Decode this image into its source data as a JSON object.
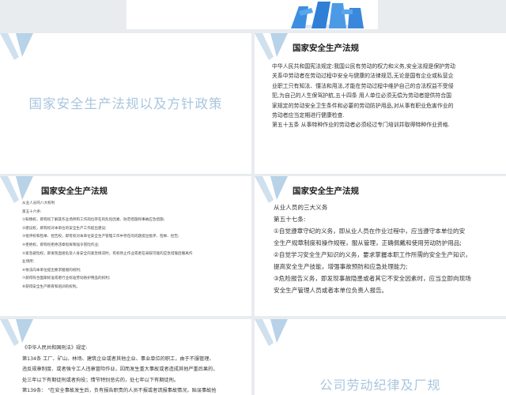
{
  "slides": {
    "s2": {
      "title": "国家安全生产法规以及方针政策"
    },
    "s3": {
      "title": "国家安全生产法规",
      "lines": [
        "中华人民共和国宪法规定:我国公民有劳动的权力和义务,安全法规是保护劳动",
        "关系中劳动者在劳动过程中安全与健康的法律规范,无论是国有企业或私营企",
        "业职工只有知法、懂法和用法,才能在劳动过程中维护自己的合法权益不受侵",
        "犯,为自己的人生保驾护航,五十四条  用人单位必须无偿为劳动者提供符合国",
        "家规定的劳动安全卫生条件和必要的劳动防护用品,对从事有职业危害作业的",
        "劳动者应当定期进行健康检查.",
        "第五十五条  从事特种作业的劳动者必须经过专门培训并取得特种作业资格."
      ]
    },
    "s4": {
      "title": "国家安全生产法规",
      "lines": [
        "从业人员的八大权利",
        "第五十六条:",
        "①知情权，即有权了解其作业场所和工作岗位存在的危险因素、防范措施和事故应急措施;",
        "②建议权，即有权对本单位的安全生产工作提出建议;",
        "③批评权和检举、控告权，即有权对本单位安全生产管理工作中存在的问题提出批评、检举、控告;",
        "④拒绝权，即有权拒绝违章指挥和强令冒险作业;",
        "⑤紧急避险权，即发现直接危及人身安全的紧急情况时，有权停止作业或者在采取可能的应急措施后撤离作",
        "业场所;",
        "⑥依法向本单位提出要求赔偿的权利;",
        "⑦获得符合国家标准或者行业标准劳动防护用品的权利;",
        "⑧获得安全生产教育和培训的权利。"
      ]
    },
    "s5": {
      "title": "国家安全生产法规",
      "lines": [
        "从业人员的三大义务",
        "第五十七条:",
        "    ①自觉遵章守纪的义务，即从业人员在作业过程中，应当遵守本单位的安",
        "全生产规章制度和操作规程，服从管理，正确佩戴和使用劳动防护用品;",
        "    ②自觉学习安全生产知识的义务，要求掌握本职工作所需的安全生产知识，",
        "提高安全生产技能，增强事故预防和应急处理能力;",
        "    ③危险报告义务，即发现事故隐患或者其它不安全因素时，应当立即向现场",
        "安全生产管理人员或者本单位负责人报告。"
      ]
    },
    "s6": {
      "lines": [
        "《中华人民共和国刑法》规定:",
        "    第134条  工厂、矿山、林场、建筑企业或者其他企业、事业单位的职工，由于不服管理、",
        "违反规章制度、或者强令工人违章冒险作业，因而发生重大事故或者造成其他严重后果的，",
        "处三年以下有期徒刑或者拘役；情节特别恶劣的，处七年以下有期徒刑。",
        "    第139条：  \"在安全事故发生后，负有报告职责的人员不报或者谎报事故情况，贻误事故抢"
      ]
    },
    "s7": {
      "title": "公司劳动纪律及厂规"
    }
  }
}
